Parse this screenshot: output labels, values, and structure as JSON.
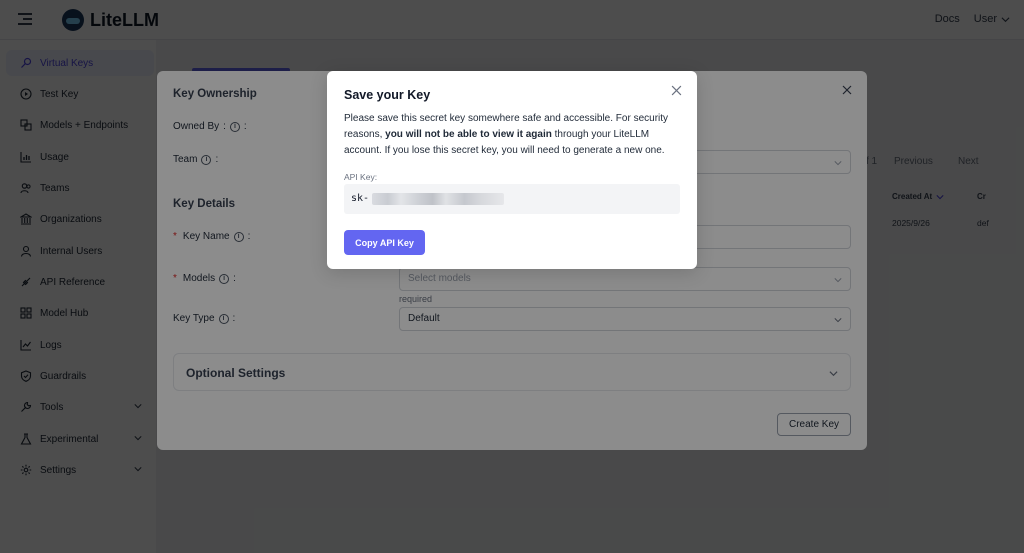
{
  "app": {
    "name": "LiteLLM"
  },
  "topnav": {
    "docs": "Docs",
    "user": "User"
  },
  "sidebar": {
    "items": [
      {
        "label": "Virtual Keys",
        "icon": "key-icon",
        "active": true
      },
      {
        "label": "Test Key",
        "icon": "play-circle-icon"
      },
      {
        "label": "Models + Endpoints",
        "icon": "block-icon"
      },
      {
        "label": "Usage",
        "icon": "bar-chart-icon"
      },
      {
        "label": "Teams",
        "icon": "team-icon"
      },
      {
        "label": "Organizations",
        "icon": "bank-icon"
      },
      {
        "label": "Internal Users",
        "icon": "user-icon"
      },
      {
        "label": "API Reference",
        "icon": "api-icon"
      },
      {
        "label": "Model Hub",
        "icon": "appstore-icon"
      },
      {
        "label": "Logs",
        "icon": "line-chart-icon"
      },
      {
        "label": "Guardrails",
        "icon": "safety-icon"
      },
      {
        "label": "Tools",
        "icon": "tool-icon",
        "expandable": true
      },
      {
        "label": "Experimental",
        "icon": "experiment-icon",
        "expandable": true
      },
      {
        "label": "Settings",
        "icon": "setting-icon",
        "expandable": true
      }
    ]
  },
  "background": {
    "pagination": {
      "page_suffix": "f 1",
      "previous": "Previous",
      "next": "Next"
    },
    "table": {
      "col_created_at": "Created At",
      "col_created_by": "Cr",
      "row_created_at": "2025/9/26",
      "row_created_by": "def"
    }
  },
  "create_key_modal": {
    "section_ownership": "Key Ownership",
    "owned_by_label": "Owned By",
    "team_label": "Team",
    "section_details": "Key Details",
    "key_name_label": "Key Name",
    "models_label": "Models",
    "models_placeholder": "Select models",
    "models_hint": "required",
    "key_type_label": "Key Type",
    "key_type_value": "Default",
    "optional_settings": "Optional Settings",
    "create_button": "Create Key"
  },
  "save_key_modal": {
    "title": "Save your Key",
    "body_part1": "Please save this secret key somewhere safe and accessible. For security reasons, ",
    "body_bold": "you will not be able to view it again",
    "body_part2": " through your LiteLLM account. If you lose this secret key, you will need to generate a new one.",
    "api_key_label": "API Key:",
    "api_key_prefix": "sk-",
    "copy_button": "Copy API Key"
  },
  "colors": {
    "primary": "#6366f1",
    "overlay": "rgba(0,0,0,0.45)"
  }
}
